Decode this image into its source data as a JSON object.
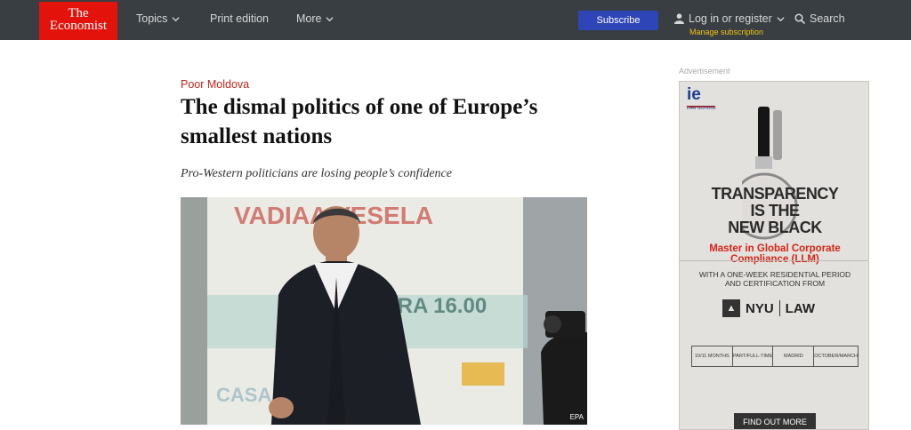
{
  "nav": {
    "logo_line1": "The",
    "logo_line2": "Economist",
    "topics": "Topics",
    "print_edition": "Print edition",
    "more": "More",
    "subscribe": "Subscribe",
    "login": "Log in or register",
    "manage_subscription": "Manage subscription",
    "search": "Search"
  },
  "article": {
    "kicker": "Poor Moldova",
    "headline": "The dismal politics of one of Europe’s smallest nations",
    "standfirst": "Pro-Western politicians are losing people’s confidence",
    "image_credit": "EPA"
  },
  "ad": {
    "label": "Advertisement",
    "brand": "ie",
    "brand_sub": "LAW SCHOOL",
    "headline_lines": [
      "TRANSPARENCY",
      "IS THE",
      "NEW BLACK"
    ],
    "subhead": "Master in Global Corporate Compliance (LLM)",
    "text_line1": "WITH A ONE-WEEK RESIDENTIAL PERIOD",
    "text_line2": "AND CERTIFICATION FROM",
    "partner_a": "NYU",
    "partner_b": "LAW",
    "table": [
      "10/11 MONTHS",
      "PART/FULL-TIME",
      "MADRID",
      "OCTOBER/MARCH"
    ],
    "cta": "FIND OUT MORE"
  },
  "colors": {
    "nav_bg": "#383e42",
    "brand_red": "#e3120b",
    "subscribe_blue": "#2e45b8",
    "kicker_red": "#c5231a",
    "manage_yellow": "#f2c317"
  }
}
